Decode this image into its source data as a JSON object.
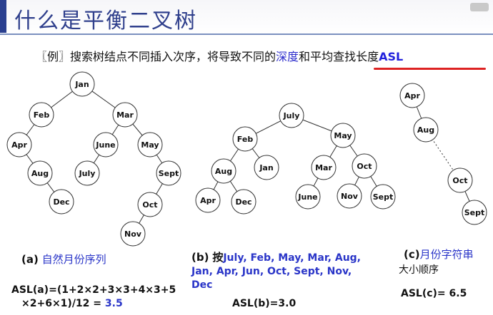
{
  "title": "什么是平衡二叉树",
  "example": {
    "bracket": "〖例〗",
    "text1": "搜索树结点不同插入次序，将导致不同的",
    "depth": "深度",
    "and": "和",
    "avg": "平均查找长度",
    "asl": "ASL"
  },
  "tree_a": {
    "nodes": [
      "Jan",
      "Feb",
      "Mar",
      "Apr",
      "June",
      "May",
      "Aug",
      "July",
      "Sept",
      "Dec",
      "Oct",
      "Nov"
    ]
  },
  "tree_b": {
    "nodes": [
      "July",
      "Feb",
      "May",
      "Aug",
      "Jan",
      "Mar",
      "Oct",
      "Apr",
      "Dec",
      "June",
      "Nov",
      "Sept"
    ]
  },
  "tree_c": {
    "nodes": [
      "Apr",
      "Aug",
      "Oct",
      "Sept"
    ]
  },
  "caption_a": {
    "label": "(a)",
    "text": "自然月份序列"
  },
  "caption_b": {
    "label": "(b)",
    "lead": "按",
    "months": "July, Feb, May, Mar, Aug, Jan, Apr, Jun, Oct, Sept, Nov, Dec"
  },
  "caption_c": {
    "label": "(c)",
    "text1": "月份字符串",
    "text2": "大小顺序"
  },
  "asl_a": {
    "line1": "ASL(a)=(1+2×2+3×3+4×3+5",
    "line2": "×2+6×1)/12 = ",
    "result": "3.5"
  },
  "asl_b": "ASL(b)=3.0",
  "asl_c": "ASL(c)= 6.5"
}
